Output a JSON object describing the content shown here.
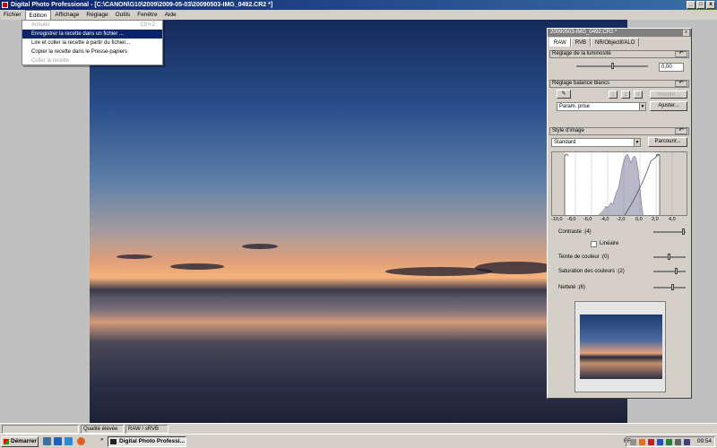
{
  "window": {
    "title": "Digital Photo Professional - [C:\\CANON\\G10\\2009\\2009-05-03\\20090503-IMG_0492.CR2 *]",
    "min": "_",
    "max": "□",
    "close": "x"
  },
  "menubar": [
    "Fichier",
    "Edition",
    "Affichage",
    "Réglage",
    "Outils",
    "Fenêtre",
    "Aide"
  ],
  "edit_menu": {
    "items": [
      {
        "label": "Annuler",
        "shortcut": "Ctrl+Z"
      },
      {
        "label": "Enregistrer la recette dans un fichier ..."
      },
      {
        "label": "Lire et coller la recette à partir du fichier..."
      },
      {
        "label": "Copier la recette dans le Presse-papiers"
      },
      {
        "label": "Coller la recette"
      }
    ]
  },
  "tool_palette": {
    "title": "20090503-IMG_0492.CR2 *",
    "close": "x",
    "tabs": [
      "RAW",
      "RVB",
      "NR/Objectif/ALO"
    ],
    "brightness": {
      "header": "Réglage de la luminosité",
      "value": "0,00",
      "reset": "↶"
    },
    "white_balance": {
      "header": "Réglage balance blancs",
      "reset": "↶",
      "register_btn": "Inscrire...",
      "num_btns": [
        "1",
        "2",
        "3"
      ],
      "preset": "Param. prise",
      "adjust_btn": "Ajuster..."
    },
    "picture_style": {
      "header": "Style d'image",
      "reset": "↶",
      "style": "Standard",
      "browse_btn": "Parcourir...",
      "axis_ticks": [
        "-10,0",
        "-8,0",
        "-6,0",
        "-4,0",
        "-2,0",
        "0,0",
        "2,0",
        "4,0"
      ],
      "contrast_label": "Contraste :(4)",
      "linear_label": "Linéaire",
      "tone_label": "Teinte de couleur :(0)",
      "saturation_label": "Saturation des couleurs :(2)",
      "sharpness_label": "Netteté :(6)"
    }
  },
  "statusbar": {
    "quality": "Qualité élevée",
    "mode": "RAW / sRVB"
  },
  "taskbar": {
    "start": "Démarrer",
    "active_app": "Digital Photo Professi...",
    "lang": "FR",
    "clock": "09:54"
  }
}
